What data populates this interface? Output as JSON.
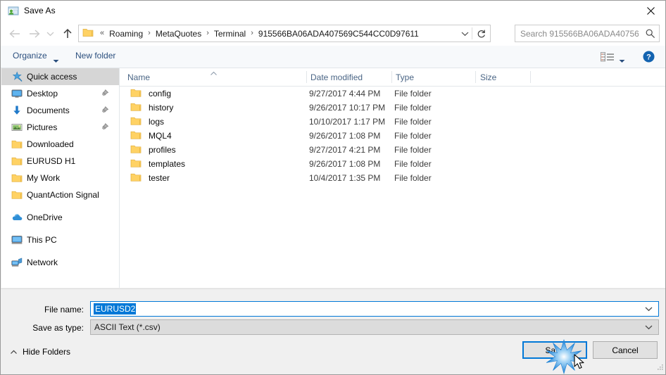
{
  "window": {
    "title": "Save As",
    "icon": "save-as-icon",
    "close_label": "✕"
  },
  "nav": {
    "back_icon": "back-arrow-icon",
    "forward_icon": "forward-arrow-icon",
    "recent_icon": "recent-locations-chevron-icon",
    "up_icon": "up-arrow-icon",
    "address": {
      "root_icon": "folder-icon",
      "leading_separator": "«",
      "crumbs": [
        "Roaming",
        "MetaQuotes",
        "Terminal",
        "915566BA06ADA407569C544CC0D97611"
      ],
      "separator": "›",
      "dropdown_icon": "chevron-down-icon",
      "refresh_icon": "refresh-icon"
    },
    "search": {
      "placeholder": "Search 915566BA06ADA40756...",
      "icon": "search-icon"
    }
  },
  "toolbar": {
    "organize_label": "Organize",
    "organize_caret": "▾",
    "new_folder_label": "New folder",
    "view_icon": "list-view-icon",
    "view_caret": "▾",
    "help_icon": "help-icon",
    "help_glyph": "?"
  },
  "sidebar": {
    "items": [
      {
        "label": "Quick access",
        "icon": "star-pin-icon",
        "level": "root",
        "selected": true,
        "pinned": false
      },
      {
        "label": "Desktop",
        "icon": "desktop-icon",
        "level": "lvl1",
        "selected": false,
        "pinned": true
      },
      {
        "label": "Documents",
        "icon": "documents-icon",
        "level": "lvl1",
        "selected": false,
        "pinned": true
      },
      {
        "label": "Pictures",
        "icon": "pictures-icon",
        "level": "lvl1",
        "selected": false,
        "pinned": true
      },
      {
        "label": "Downloaded",
        "icon": "folder-icon",
        "level": "lvl1",
        "selected": false,
        "pinned": false
      },
      {
        "label": "EURUSD H1",
        "icon": "folder-icon",
        "level": "lvl1",
        "selected": false,
        "pinned": false
      },
      {
        "label": "My Work",
        "icon": "folder-icon",
        "level": "lvl1",
        "selected": false,
        "pinned": false
      },
      {
        "label": "QuantAction Signal",
        "icon": "folder-icon",
        "level": "lvl1",
        "selected": false,
        "pinned": false
      },
      {
        "label": "OneDrive",
        "icon": "onedrive-icon",
        "level": "root",
        "selected": false,
        "pinned": false,
        "gap_before": true
      },
      {
        "label": "This PC",
        "icon": "this-pc-icon",
        "level": "root",
        "selected": false,
        "pinned": false,
        "gap_before": true
      },
      {
        "label": "Network",
        "icon": "network-icon",
        "level": "root",
        "selected": false,
        "pinned": false,
        "gap_before": true
      }
    ]
  },
  "file_list": {
    "columns": [
      "Name",
      "Date modified",
      "Type",
      "Size"
    ],
    "sort_column": "Name",
    "sort_caret": "˄",
    "rows": [
      {
        "name": "config",
        "date": "9/27/2017 4:44 PM",
        "type": "File folder",
        "size": "",
        "icon": "folder-icon"
      },
      {
        "name": "history",
        "date": "9/26/2017 10:17 PM",
        "type": "File folder",
        "size": "",
        "icon": "folder-icon"
      },
      {
        "name": "logs",
        "date": "10/10/2017 1:17 PM",
        "type": "File folder",
        "size": "",
        "icon": "folder-icon"
      },
      {
        "name": "MQL4",
        "date": "9/26/2017 1:08 PM",
        "type": "File folder",
        "size": "",
        "icon": "folder-icon"
      },
      {
        "name": "profiles",
        "date": "9/27/2017 4:21 PM",
        "type": "File folder",
        "size": "",
        "icon": "folder-icon"
      },
      {
        "name": "templates",
        "date": "9/26/2017 1:08 PM",
        "type": "File folder",
        "size": "",
        "icon": "folder-icon"
      },
      {
        "name": "tester",
        "date": "10/4/2017 1:35 PM",
        "type": "File folder",
        "size": "",
        "icon": "folder-icon"
      }
    ]
  },
  "form": {
    "filename_label": "File name:",
    "filename_value": "EURUSD2",
    "savetype_label": "Save as type:",
    "savetype_value": "ASCII Text (*.csv)",
    "dropdown_icon": "chevron-down-icon"
  },
  "footer": {
    "hide_folders_label": "Hide Folders",
    "hide_folders_caret": "˄",
    "save_label": "Save",
    "cancel_label": "Cancel",
    "cursor_icon": "mouse-cursor-icon",
    "click_effect_icon": "click-burst-icon"
  },
  "colors": {
    "accent": "#0078d7",
    "selection": "#0078d7",
    "sidebar_selected": "#d6d6d6",
    "dialog_bg": "#f0f0f0",
    "pane_bg": "#ffffff",
    "header_text": "#4a6585",
    "toolbar_text": "#2b4f7e",
    "folder_yellow": "#ffd264"
  }
}
